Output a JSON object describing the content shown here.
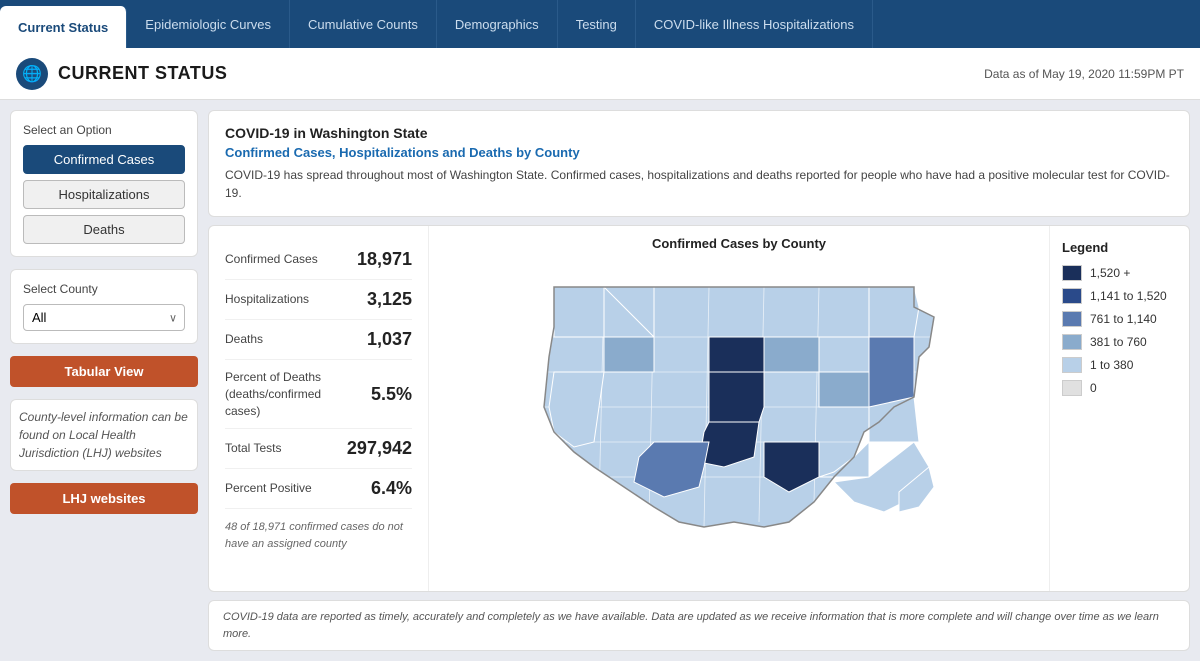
{
  "nav": {
    "tabs": [
      {
        "id": "current-status",
        "label": "Current Status",
        "active": true
      },
      {
        "id": "epidemiologic-curves",
        "label": "Epidemiologic Curves",
        "active": false
      },
      {
        "id": "cumulative-counts",
        "label": "Cumulative Counts",
        "active": false
      },
      {
        "id": "demographics",
        "label": "Demographics",
        "active": false
      },
      {
        "id": "testing",
        "label": "Testing",
        "active": false
      },
      {
        "id": "covid-hospitalizations",
        "label": "COVID-like Illness Hospitalizations",
        "active": false
      }
    ]
  },
  "header": {
    "title": "CURRENT STATUS",
    "logo_symbol": "🌐",
    "date_label": "Data as of May 19, 2020 11:59PM PT"
  },
  "sidebar": {
    "option_section_label": "Select an Option",
    "options": [
      {
        "id": "confirmed-cases",
        "label": "Confirmed Cases",
        "active": true
      },
      {
        "id": "hospitalizations",
        "label": "Hospitalizations",
        "active": false
      },
      {
        "id": "deaths",
        "label": "Deaths",
        "active": false
      }
    ],
    "county_section_label": "Select County",
    "county_default": "All",
    "tabular_btn_label": "Tabular View",
    "info_text": "County-level information can be found on Local Health Jurisdiction (LHJ) websites",
    "lhj_btn_label": "LHJ websites"
  },
  "info_card": {
    "heading": "COVID-19 in Washington State",
    "subheading": "Confirmed Cases, Hospitalizations and Deaths by County",
    "description": "COVID-19 has spread throughout most of Washington State. Confirmed cases, hospitalizations and deaths reported for people who have had a positive molecular test for COVID-19."
  },
  "stats": {
    "title": "Confirmed Cases by County",
    "rows": [
      {
        "label": "Confirmed Cases",
        "value": "18,971"
      },
      {
        "label": "Hospitalizations",
        "value": "3,125"
      },
      {
        "label": "Deaths",
        "value": "1,037"
      },
      {
        "label": "Percent of Deaths\n(deaths/confirmed\ncases)",
        "value": "5.5%"
      },
      {
        "label": "Total Tests",
        "value": "297,942"
      },
      {
        "label": "Percent Positive",
        "value": "6.4%"
      }
    ],
    "note": "48 of 18,971 confirmed cases do not have an assigned county"
  },
  "legend": {
    "title": "Legend",
    "items": [
      {
        "label": "1,520 +",
        "color": "#1a2f5a"
      },
      {
        "label": "1,141 to 1,520",
        "color": "#2a4a8a"
      },
      {
        "label": "761 to 1,140",
        "color": "#5a7ab0"
      },
      {
        "label": "381 to 760",
        "color": "#8aabcc"
      },
      {
        "label": "1 to 380",
        "color": "#b8d0e8"
      },
      {
        "label": "0",
        "color": "#e0e0e0"
      }
    ]
  },
  "footer": {
    "note": "COVID-19 data are reported as timely, accurately and completely as we have available. Data are updated as we receive information that is more complete and will change over time as we learn more."
  }
}
